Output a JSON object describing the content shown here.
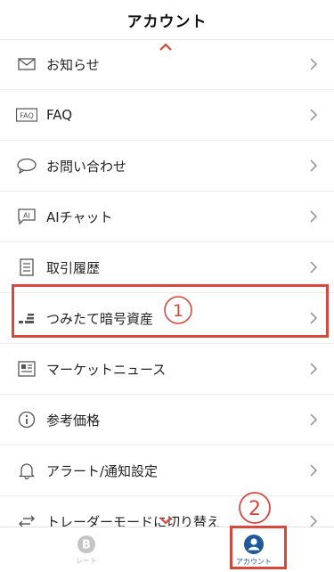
{
  "header": {
    "title": "アカウント"
  },
  "menu": [
    {
      "label": "お知らせ",
      "icon": "mail-icon"
    },
    {
      "label": "FAQ",
      "icon": "faq-icon"
    },
    {
      "label": "お問い合わせ",
      "icon": "chat-bubble-icon"
    },
    {
      "label": "AIチャット",
      "icon": "ai-chat-icon"
    },
    {
      "label": "取引履歴",
      "icon": "list-document-icon"
    },
    {
      "label": "つみたて暗号資産",
      "icon": "stack-bars-icon"
    },
    {
      "label": "マーケットニュース",
      "icon": "news-icon"
    },
    {
      "label": "参考価格",
      "icon": "info-icon"
    },
    {
      "label": "アラート/通知設定",
      "icon": "bell-icon"
    },
    {
      "label": "トレーダーモードに切り替え",
      "icon": "swap-arrows-icon"
    }
  ],
  "annotations": {
    "step1": "①",
    "step2": "②"
  },
  "tabbar": {
    "rate_label": "レート",
    "account_label": "アカウント"
  },
  "colors": {
    "highlight": "#d8483a",
    "active_tab": "#1f5a9c",
    "inactive_tab": "#b7b7b7",
    "icon": "#555555"
  }
}
